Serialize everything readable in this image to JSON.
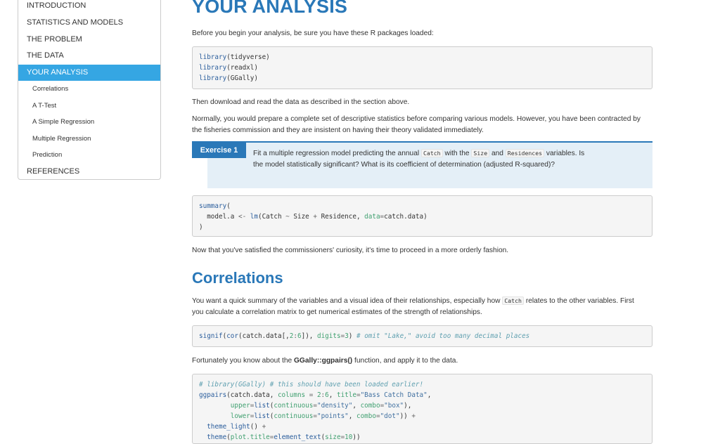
{
  "sidebar": {
    "items": [
      {
        "label": "INTRODUCTION"
      },
      {
        "label": "STATISTICS AND MODELS"
      },
      {
        "label": "THE PROBLEM"
      },
      {
        "label": "THE DATA"
      },
      {
        "label": "YOUR ANALYSIS"
      },
      {
        "label": "Correlations"
      },
      {
        "label": "A T-Test"
      },
      {
        "label": "A Simple Regression"
      },
      {
        "label": "Multiple Regression"
      },
      {
        "label": "Prediction"
      },
      {
        "label": "REFERENCES"
      }
    ],
    "active_label": "YOUR ANALYSIS"
  },
  "main": {
    "title": "YOUR ANALYSIS",
    "intro": "Before you begin your analysis, be sure you have these R packages loaded:",
    "libraries": {
      "fn": "library",
      "pkgs": [
        "tidyverse",
        "readxl",
        "GGally"
      ]
    },
    "p_download": "Then download and read the data as described in the section above.",
    "p_normally": "Normally, you would prepare a complete set of descriptive statistics before comparing various models. However, you have been contracted by the fisheries commission and they are insistent on having their theory validated immediately.",
    "exercise": {
      "label": "Exercise 1",
      "t1": "Fit a multiple regression model predicting the annual ",
      "c1": "Catch",
      "t2": " with the ",
      "c2": "Size",
      "t3": " and ",
      "c3": "Residences",
      "t4": " variables. Is the model statistically significant? What is its coefficient of determination (adjusted R-squared)?"
    },
    "code_summary": {
      "l1_fn": "summary",
      "l1_rest": "(",
      "l2_a": "  model.a ",
      "l2_op": "<-",
      "l2_fn": " lm",
      "l2_b": "(Catch ",
      "l2_tilde": "~",
      "l2_c": " Size ",
      "l2_plus": "+",
      "l2_d": " Residence, ",
      "l2_arg": "data",
      "l2_eq": "=",
      "l2_e": "catch.data)",
      "l3": ")"
    },
    "p_now": "Now that you've satisfied the commissioners' curiosity, it's time to proceed in a more orderly fashion.",
    "corr_title": "Correlations",
    "p_want_1": "You want a quick summary of the variables and a visual idea of their relationships, especially how ",
    "p_want_code": "Catch",
    "p_want_2": " relates to the other variables. First you calculate a correlation matrix to get numerical estimates of the strength of relationships.",
    "code_signif": {
      "fn1": "signif",
      "p1": "(",
      "fn2": "cor",
      "p2": "(catch.data[,",
      "num1": "2",
      "colon": ":",
      "num2": "6",
      "p3": "]), ",
      "arg": "digits",
      "eq": "=",
      "num3": "3",
      "p4": ") ",
      "cmt": "# omit \"Lake,\" avoid too many decimal places"
    },
    "p_fort_1": "Fortunately you know about the ",
    "p_fort_bold": "GGally::ggpairs()",
    "p_fort_2": " function, and apply it to the data.",
    "code_ggpairs": {
      "l1_cmt": "# library(GGally) # this should have been loaded earlier!",
      "l2_fn": "ggpairs",
      "l2_a": "(catch.data, ",
      "l2_arg1": "columns",
      "l2_eq1": " = ",
      "l2_num1": "2",
      "l2_colon": ":",
      "l2_num2": "6",
      "l2_b": ", ",
      "l2_arg2": "title",
      "l2_eq2": "=",
      "l2_str": "\"Bass Catch Data\"",
      "l2_c": ",",
      "l3_indent": "        ",
      "l3_arg": "upper",
      "l3_eq": "=",
      "l3_fn": "list",
      "l3_a": "(",
      "l3_arg2": "continuous",
      "l3_eq2": "=",
      "l3_str1": "\"density\"",
      "l3_b": ", ",
      "l3_arg3": "combo",
      "l3_eq3": "=",
      "l3_str2": "\"box\"",
      "l3_c": "),",
      "l4_indent": "        ",
      "l4_arg": "lower",
      "l4_eq": "=",
      "l4_fn": "list",
      "l4_a": "(",
      "l4_arg2": "continuous",
      "l4_eq2": "=",
      "l4_str1": "\"points\"",
      "l4_b": ", ",
      "l4_arg3": "combo",
      "l4_eq3": "=",
      "l4_str2": "\"dot\"",
      "l4_c": ")) ",
      "l4_plus": "+",
      "l5_fn": "  theme_light",
      "l5_a": "() ",
      "l5_plus": "+",
      "l6_fn": "  theme",
      "l6_a": "(",
      "l6_arg": "plot.title",
      "l6_eq": "=",
      "l6_fn2": "element_text",
      "l6_b": "(",
      "l6_arg2": "size",
      "l6_eq2": "=",
      "l6_num": "10",
      "l6_c": "))"
    }
  }
}
